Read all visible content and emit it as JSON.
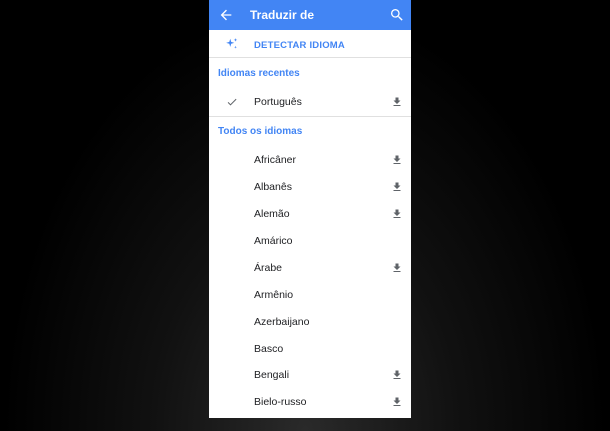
{
  "header": {
    "title": "Traduzir de",
    "back_icon": "arrow-left-icon",
    "search_icon": "search-icon",
    "color": "#4285f4"
  },
  "detect": {
    "label": "DETECTAR IDIOMA",
    "icon": "sparkle-icon"
  },
  "recent": {
    "heading": "Idiomas recentes",
    "items": [
      {
        "label": "Português",
        "selected": true,
        "downloadable": true
      }
    ]
  },
  "all": {
    "heading": "Todos os idiomas",
    "items": [
      {
        "label": "Africâner",
        "downloadable": true
      },
      {
        "label": "Albanês",
        "downloadable": true
      },
      {
        "label": "Alemão",
        "downloadable": true
      },
      {
        "label": "Amárico",
        "downloadable": false
      },
      {
        "label": "Árabe",
        "downloadable": true
      },
      {
        "label": "Armênio",
        "downloadable": false
      },
      {
        "label": "Azerbaijano",
        "downloadable": false
      },
      {
        "label": "Basco",
        "downloadable": false
      },
      {
        "label": "Bengali",
        "downloadable": true
      },
      {
        "label": "Bielo-russo",
        "downloadable": true
      }
    ]
  }
}
